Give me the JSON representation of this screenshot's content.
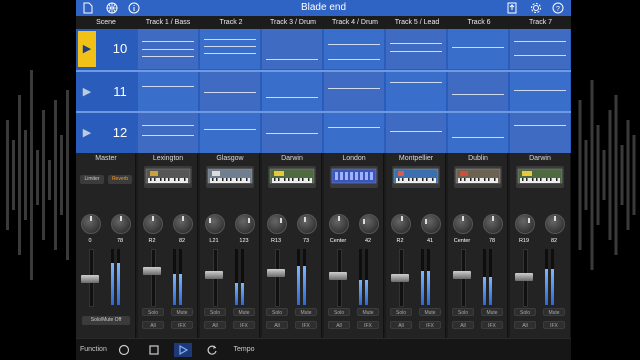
{
  "app": {
    "title": "Blade end"
  },
  "toolbar": {
    "left_icons": [
      "document-icon",
      "globe-icon",
      "info-icon"
    ],
    "right_icons": [
      "export-icon",
      "gear-icon",
      "help-icon"
    ]
  },
  "header": {
    "scene_label": "Scene",
    "tracks": [
      "Track 1 / Bass",
      "Track 2",
      "Track 3 / Drum",
      "Track 4 / Drum",
      "Track 5 / Lead",
      "Track 6",
      "Track 7"
    ]
  },
  "scenes": [
    {
      "number": "10",
      "active": true
    },
    {
      "number": "11",
      "active": false
    },
    {
      "number": "12",
      "active": false
    }
  ],
  "mixer": {
    "master": {
      "name": "Master",
      "btn_left": "Limiter",
      "btn_right": "Reverb",
      "val_left": "0",
      "val_right": "78",
      "bottom_label": "Solo/Mute Off"
    },
    "channels": [
      {
        "name": "Lexington",
        "val_left": "R2",
        "val_right": "82",
        "b1": "Solo",
        "b2": "Mute",
        "b3": "All",
        "b4": "IFX"
      },
      {
        "name": "Glasgow",
        "val_left": "L21",
        "val_right": "123",
        "b1": "Solo",
        "b2": "Mute",
        "b3": "All",
        "b4": "IFX"
      },
      {
        "name": "Darwin",
        "val_left": "R13",
        "val_right": "73",
        "b1": "Solo",
        "b2": "Mute",
        "b3": "All",
        "b4": "IFX"
      },
      {
        "name": "London",
        "val_left": "Center",
        "val_right": "42",
        "b1": "Solo",
        "b2": "Mute",
        "b3": "All",
        "b4": "IFX"
      },
      {
        "name": "Montpellier",
        "val_left": "R2",
        "val_right": "41",
        "b1": "Solo",
        "b2": "Mute",
        "b3": "All",
        "b4": "IFX"
      },
      {
        "name": "Dublin",
        "val_left": "Center",
        "val_right": "78",
        "b1": "Solo",
        "b2": "Mute",
        "b3": "All",
        "b4": "IFX"
      },
      {
        "name": "Darwin",
        "val_left": "R19",
        "val_right": "82",
        "b1": "Solo",
        "b2": "Mute",
        "b3": "All",
        "b4": "IFX"
      }
    ],
    "fader_levels": [
      0.45,
      0.62,
      0.55,
      0.58,
      0.52,
      0.48,
      0.55,
      0.5
    ],
    "meter_levels": [
      0.75,
      0.55,
      0.4,
      0.7,
      0.45,
      0.6,
      0.5,
      0.65
    ]
  },
  "transport": {
    "function_label": "Function",
    "tempo_label": "Tempo",
    "icons": [
      "record-icon",
      "stop-icon",
      "play-icon",
      "loop-icon"
    ]
  },
  "colors": {
    "accent": "#f2c118",
    "clip_blue": "#2a5cbc",
    "topbar": "#2f64c4"
  }
}
